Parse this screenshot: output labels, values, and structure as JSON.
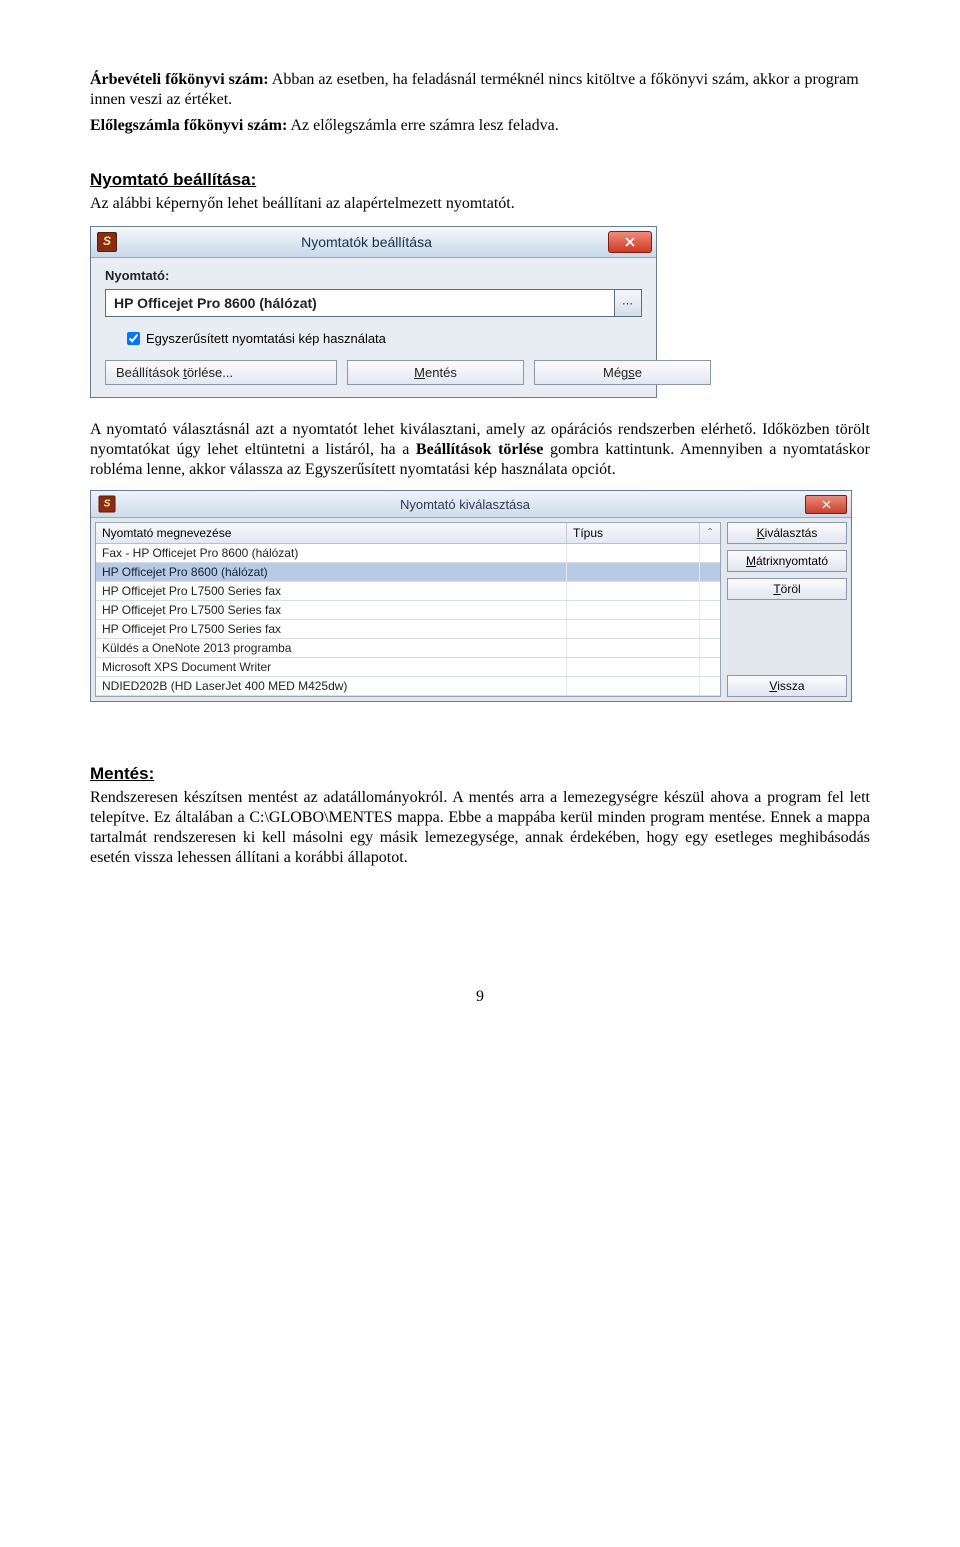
{
  "para1_lead": "Árbevételi főkönyvi szám:",
  "para1_rest": " Abban az esetben, ha feladásnál terméknél nincs kitöltve a főkönyvi szám, akkor a program innen veszi az értéket.",
  "para2_lead": "Előlegszámla főkönyvi szám:",
  "para2_rest": " Az előlegszámla erre számra lesz feladva.",
  "sec1_heading": "Nyomtató beállítása:",
  "sec1_text": "Az alábbi képernyőn lehet beállítani az alapértelmezett nyomtatót.",
  "dlg1": {
    "title": "Nyomtatók beállítása",
    "label": "Nyomtató:",
    "value": "HP Officejet Pro 8600 (hálózat)",
    "checkbox_label": "Egyszerűsített nyomtatási kép használata",
    "btn_clear": "Beállítások törlése...",
    "btn_save": "Mentés",
    "btn_cancel": "Mégse"
  },
  "mid_para": {
    "a": "A nyomtató választásnál azt a nyomtatót lehet kiválasztani, amely az opárációs rendszerben elérhető. Időközben törölt nyomtatókat úgy lehet eltüntetni a listáról, ha a ",
    "b_bold": "Beállítások törlése",
    "c": " gombra kattintunk. Amennyiben a nyomtatáskor robléma lenne, akkor válassza az Egyszerűsített nyomtatási kép használata opciót."
  },
  "dlg2": {
    "title": "Nyomtató kiválasztása",
    "col1": "Nyomtató megnevezése",
    "col2": "Típus",
    "rows": [
      "Fax - HP Officejet Pro 8600 (hálózat)",
      "HP Officejet Pro 8600 (hálózat)",
      "HP Officejet Pro L7500 Series fax",
      "HP Officejet Pro L7500 Series fax",
      "HP Officejet Pro L7500 Series fax",
      "Küldés a OneNote 2013 programba",
      "Microsoft XPS Document Writer",
      "NDIED202B (HD LaserJet 400 MED M425dw)"
    ],
    "selected_index": 1,
    "btn_select": "Kiválasztás",
    "btn_matrix": "Mátrixnyomtató",
    "btn_delete": "Töröl",
    "btn_back": "Vissza"
  },
  "sec2_heading": "Mentés:",
  "sec2_text": "Rendszeresen készítsen mentést az adatállományokról. A mentés arra a lemezegységre készül ahova a program fel lett telepítve. Ez általában a C:\\GLOBO\\MENTES mappa. Ebbe a mappába kerül minden program mentése. Ennek a mappa tartalmát rendszeresen ki kell másolni egy másik lemezegysége, annak érdekében, hogy egy esetleges meghibásodás esetén vissza lehessen állítani a korábbi állapotot.",
  "page_number": "9"
}
